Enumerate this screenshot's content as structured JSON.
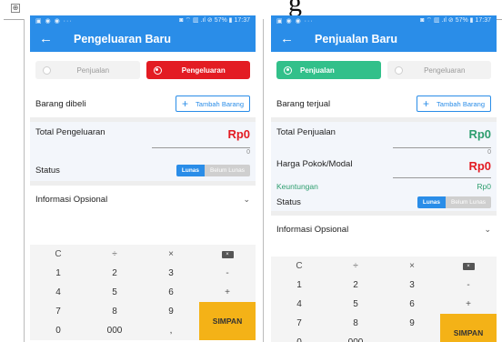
{
  "page": {
    "heading_glyph": "g",
    "move_handle": "⊕"
  },
  "left_screen": {
    "status_bar": {
      "left_icons": "▣ ◉ ◉ ···",
      "right_icons": "◙ ⌔ ▥ .ıl ⊘ 57% ▮ 17:37"
    },
    "back_icon": "←",
    "title": "Pengeluaran Baru",
    "toggle_sale": "Penjualan",
    "toggle_expense": "Pengeluaran",
    "items_label": "Barang dibeli",
    "add_item_button": "Tambah Barang",
    "add_icon": "+",
    "total_label": "Total Pengeluaran",
    "total_value": "Rp0",
    "total_sub_value": "0",
    "status_label": "Status",
    "status_paid": "Lunas",
    "status_unpaid": "Belum Lunas",
    "optional_info_label": "Informasi Opsional",
    "chevron": "⌄"
  },
  "right_screen": {
    "status_bar": {
      "left_icons": "▣ ◉ ◉ ···",
      "right_icons": "◙ ⌔ ▥ .ıl ⊘ 57% ▮ 17:37"
    },
    "back_icon": "←",
    "title": "Penjualan Baru",
    "toggle_sale": "Penjualan",
    "toggle_expense": "Pengeluaran",
    "items_label": "Barang terjual",
    "add_item_button": "Tambah Barang",
    "add_icon": "+",
    "total_label": "Total Penjualan",
    "total_value": "Rp0",
    "total_sub_value": "0",
    "cost_label": "Harga Pokok/Modal",
    "cost_value": "Rp0",
    "profit_label": "Keuntungan",
    "profit_value": "Rp0",
    "status_label": "Status",
    "status_paid": "Lunas",
    "status_unpaid": "Belum Lunas",
    "optional_info_label": "Informasi Opsional",
    "chevron": "⌄"
  },
  "keypad": {
    "clear": "C",
    "divide": "÷",
    "multiply": "×",
    "backspace": "⌫",
    "minus": "-",
    "plus": "+",
    "decimal": ",",
    "triple_zero": "000",
    "digits": [
      "0",
      "1",
      "2",
      "3",
      "4",
      "5",
      "6",
      "7",
      "8",
      "9"
    ],
    "save": "SIMPAN"
  },
  "colors": {
    "appbar": "#2a8de8",
    "expense_red": "#e31c23",
    "sale_green": "#32c08a",
    "save_yellow": "#f4b217"
  }
}
